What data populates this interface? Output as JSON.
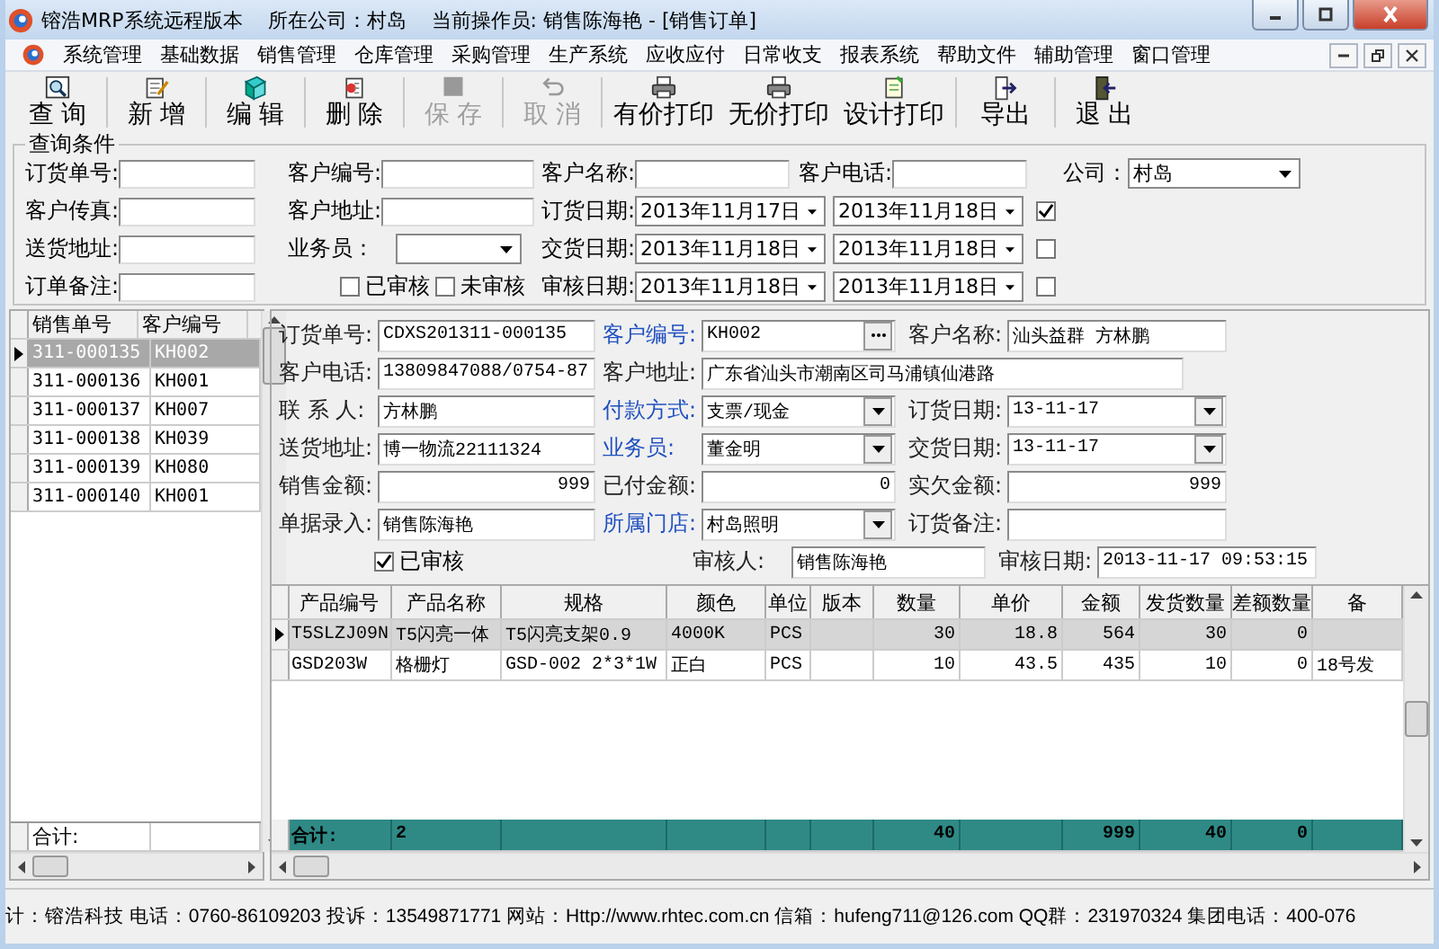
{
  "window": {
    "title": "镕浩MRP系统远程版本",
    "company": "所在公司：村岛",
    "operator": "当前操作员: 销售陈海艳 - [销售订单]"
  },
  "menu": [
    "系统管理",
    "基础数据",
    "销售管理",
    "仓库管理",
    "采购管理",
    "生产系统",
    "应收应付",
    "日常收支",
    "报表系统",
    "帮助文件",
    "辅助管理",
    "窗口管理"
  ],
  "toolbar": [
    {
      "label": "查 询",
      "disabled": false
    },
    {
      "label": "新 增",
      "disabled": false
    },
    {
      "label": "编 辑",
      "disabled": false
    },
    {
      "label": "删 除",
      "disabled": false
    },
    {
      "label": "保 存",
      "disabled": true
    },
    {
      "label": "取 消",
      "disabled": true
    },
    {
      "label": "有价打印",
      "disabled": false
    },
    {
      "label": "无价打印",
      "disabled": false
    },
    {
      "label": "设计打印",
      "disabled": false
    },
    {
      "label": "导出",
      "disabled": false
    },
    {
      "label": "退 出",
      "disabled": false
    }
  ],
  "query": {
    "legend": "查询条件",
    "rows": [
      [
        [
          {
            "kind": "field",
            "label": "订货单号:"
          }
        ],
        [
          {
            "kind": "field",
            "label": "客户编号:"
          }
        ],
        [
          {
            "kind": "field",
            "label": "客户名称:"
          },
          {
            "kind": "field",
            "label": "客户电话:"
          },
          {
            "kind": "select",
            "label": "公司：",
            "value": "村岛"
          }
        ]
      ],
      [
        [
          {
            "kind": "field",
            "label": "客户传真:"
          }
        ],
        [
          {
            "kind": "field",
            "label": "客户地址:"
          }
        ],
        [
          {
            "kind": "dates",
            "label": "订货日期:",
            "from": "2013年11月17日",
            "to": "2013年11月18日",
            "checked": true
          }
        ]
      ],
      [
        [
          {
            "kind": "field",
            "label": "送货地址:"
          }
        ],
        [
          {
            "kind": "select",
            "label": "业务员："
          }
        ],
        [
          {
            "kind": "dates",
            "label": "交货日期:",
            "from": "2013年11月18日",
            "to": "2013年11月18日",
            "checked": false
          }
        ]
      ],
      [
        [
          {
            "kind": "field",
            "label": "订单备注:"
          }
        ],
        [
          {
            "kind": "check",
            "label": "已审核",
            "checked": false
          },
          {
            "kind": "check",
            "label": "未审核",
            "checked": false
          }
        ],
        [
          {
            "kind": "dates",
            "label": "审核日期:",
            "from": "2013年11月18日",
            "to": "2013年11月18日",
            "checked": false
          }
        ]
      ]
    ]
  },
  "order_list": {
    "columns": [
      "销售单号",
      "客户编号"
    ],
    "rows": [
      {
        "order_no": "311-000135",
        "customer": "KH002",
        "selected": true
      },
      {
        "order_no": "311-000136",
        "customer": "KH001",
        "selected": false
      },
      {
        "order_no": "311-000137",
        "customer": "KH007",
        "selected": false
      },
      {
        "order_no": "311-000138",
        "customer": "KH039",
        "selected": false
      },
      {
        "order_no": "311-000139",
        "customer": "KH080",
        "selected": false
      },
      {
        "order_no": "311-000140",
        "customer": "KH001",
        "selected": false
      }
    ],
    "total_label": "合计:"
  },
  "form": {
    "rows": [
      [
        {
          "kind": "text",
          "label": "订货单号:",
          "value": "CDXS201311-000135",
          "link": false
        },
        {
          "kind": "lookup",
          "label": "客户编号:",
          "value": "KH002",
          "link": true
        },
        {
          "kind": "text",
          "label": "客户名称:",
          "value": "汕头益群 方林鹏",
          "link": false
        }
      ],
      [
        {
          "kind": "text",
          "label": "客户电话:",
          "value": "13809847088/0754-87",
          "link": false
        },
        {
          "kind": "wide",
          "label": "客户地址:",
          "value": "广东省汕头市潮南区司马浦镇仙港路",
          "link": false
        }
      ],
      [
        {
          "kind": "text",
          "label": "联 系 人:",
          "value": "方林鹏",
          "link": false
        },
        {
          "kind": "select",
          "label": "付款方式:",
          "value": "支票/现金",
          "link": true
        },
        {
          "kind": "select",
          "label": "订货日期:",
          "value": "13-11-17",
          "link": false
        }
      ],
      [
        {
          "kind": "text",
          "label": "送货地址:",
          "value": "博一物流22111324",
          "link": false
        },
        {
          "kind": "select",
          "label": "业务员:",
          "value": "董金明",
          "link": true
        },
        {
          "kind": "select",
          "label": "交货日期:",
          "value": "13-11-17",
          "link": false
        }
      ],
      [
        {
          "kind": "number",
          "label": "销售金额:",
          "value": "999",
          "link": false
        },
        {
          "kind": "number",
          "label": "已付金额:",
          "value": "0",
          "link": false
        },
        {
          "kind": "number",
          "label": "实欠金额:",
          "value": "999",
          "link": false
        }
      ],
      [
        {
          "kind": "text",
          "label": "单据录入:",
          "value": "销售陈海艳",
          "link": false
        },
        {
          "kind": "select",
          "label": "所属门店:",
          "value": "村岛照明",
          "link": true
        },
        {
          "kind": "text",
          "label": "订货备注:",
          "link": false
        }
      ],
      [
        {
          "kind": "check",
          "label": "已审核",
          "checked": true
        },
        {
          "kind": "text",
          "label": "审核人:",
          "value": "销售陈海艳",
          "link": false
        },
        {
          "kind": "text",
          "label": "审核日期:",
          "value": "2013-11-17 09:53:15",
          "link": false
        }
      ]
    ]
  },
  "items_table": {
    "columns": [
      {
        "title": "产品编号",
        "kind": "text"
      },
      {
        "title": "产品名称",
        "kind": "text"
      },
      {
        "title": "规格",
        "kind": "text"
      },
      {
        "title": "颜色",
        "kind": "text"
      },
      {
        "title": "单位",
        "kind": "text"
      },
      {
        "title": "版本",
        "kind": "text"
      },
      {
        "title": "数量",
        "kind": "number"
      },
      {
        "title": "单价",
        "kind": "number"
      },
      {
        "title": "金额",
        "kind": "number"
      },
      {
        "title": "发货数量",
        "kind": "number"
      },
      {
        "title": "差额数量",
        "kind": "number"
      },
      {
        "title": "备",
        "kind": "text"
      }
    ],
    "rows": [
      {
        "selected": true,
        "product_code": "T5SLZJ09N",
        "product_name": "T5闪亮一体",
        "spec": "T5闪亮支架0.9",
        "shade": "4000K",
        "unit": "PCS",
        "quantity": "30",
        "unit_price": "18.8",
        "amount": "564",
        "shipped_qty": "30",
        "diff_qty": "0"
      },
      {
        "selected": false,
        "product_code": "GSD203W",
        "product_name": "格栅灯",
        "spec": "GSD-002 2*3*1W",
        "shade": "正白",
        "unit": "PCS",
        "quantity": "10",
        "unit_price": "43.5",
        "amount": "435",
        "shipped_qty": "10",
        "diff_qty": "0",
        "column_12": "18号发"
      }
    ],
    "totals": {
      "product_code": "合计:",
      "product_name": "2",
      "quantity": "40",
      "amount": "999",
      "shipped_qty": "40",
      "diff_qty": "0"
    }
  },
  "status_bar": "计：镕浩科技 电话：0760-86109203 投诉：13549871771 网站：Http://www.rhtec.com.cn 信箱：hufeng711@126.com QQ群：231970324 集团电话：400-076"
}
